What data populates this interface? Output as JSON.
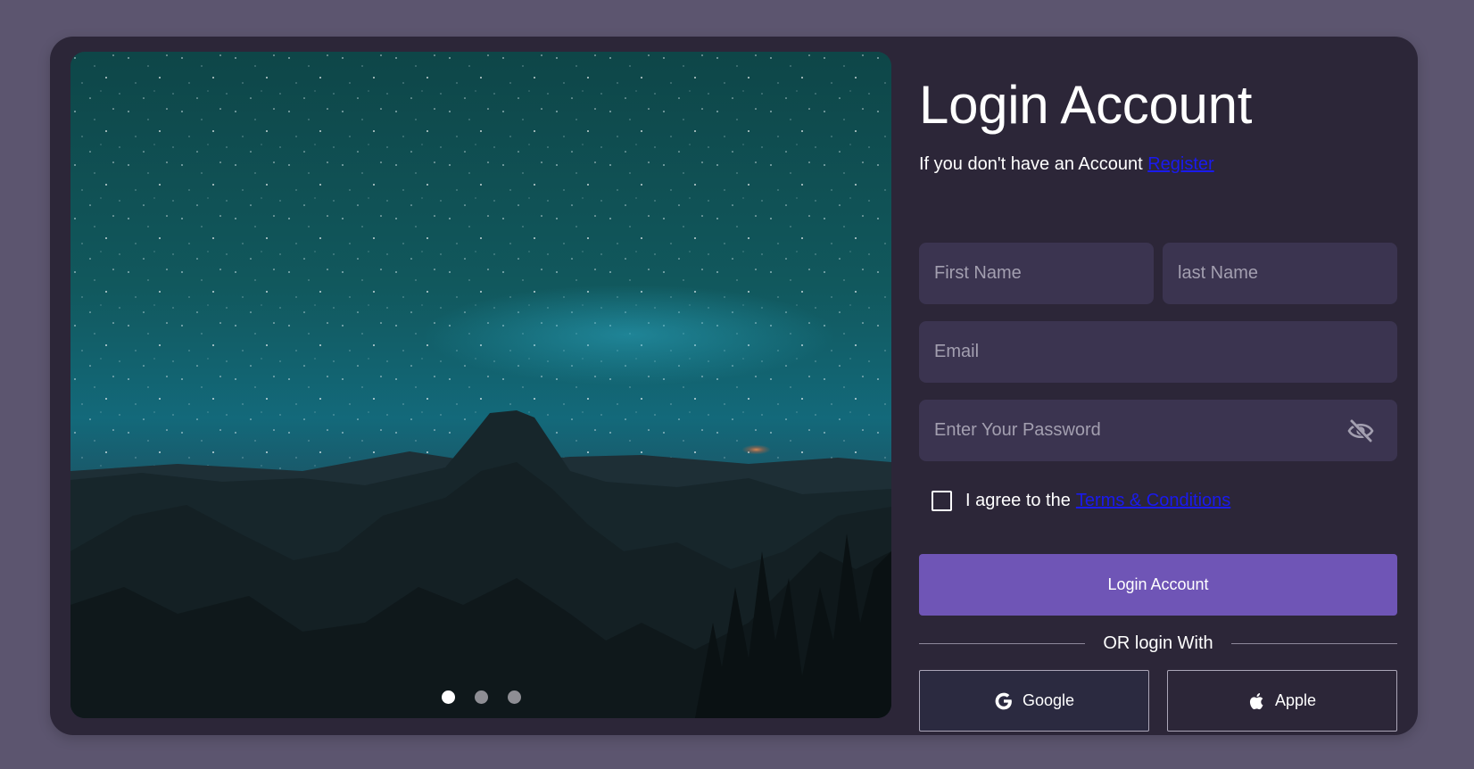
{
  "form": {
    "title": "Login Account",
    "subtitle_text": "If you don't have an Account ",
    "register_link": "Register",
    "first_name_placeholder": "First Name",
    "last_name_placeholder": "last Name",
    "email_placeholder": "Email",
    "password_placeholder": "Enter Your Password",
    "agree_text": "I agree to the ",
    "terms_link": "Terms & Conditions",
    "submit_label": "Login Account",
    "divider_text": "OR login With",
    "google_label": "Google",
    "apple_label": "Apple"
  },
  "carousel": {
    "active_index": 0,
    "slide_count": 3
  },
  "icons": {
    "password_toggle": "eye-slash-icon",
    "google": "google-icon",
    "apple": "apple-icon"
  },
  "colors": {
    "page_background": "#5c556f",
    "card_background": "#2c2638",
    "input_background": "#3b3450",
    "accent": "#6f55b6",
    "link": "#1a1aee"
  }
}
